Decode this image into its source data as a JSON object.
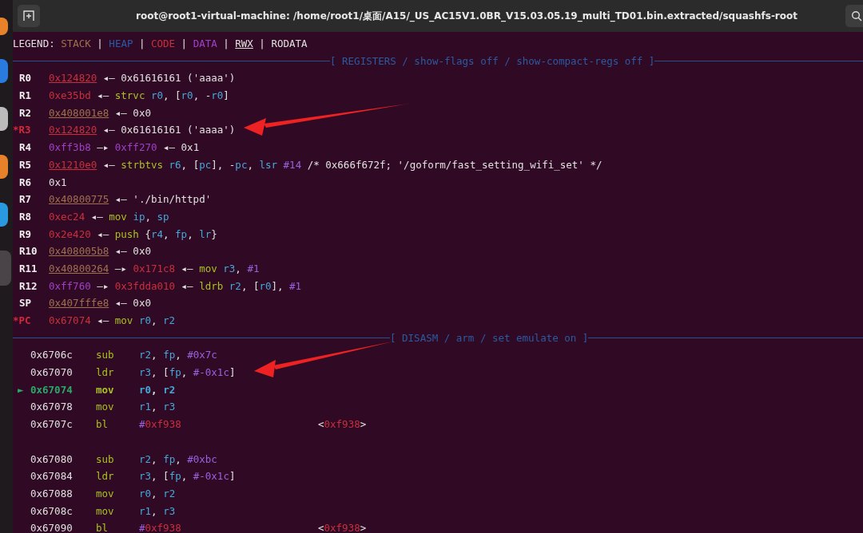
{
  "window": {
    "title": "root@root1-virtual-machine: /home/root1/桌面/A15/_US_AC15V1.0BR_V15.03.05.19_multi_TD01.bin.extracted/squashfs-root"
  },
  "legend": {
    "label": "LEGEND:",
    "separator": "|",
    "items": [
      {
        "text": "STACK",
        "kind": "stack"
      },
      {
        "text": "HEAP",
        "kind": "heap"
      },
      {
        "text": "CODE",
        "kind": "code"
      },
      {
        "text": "DATA",
        "kind": "data"
      },
      {
        "text": "RWX",
        "kind": "rwx"
      },
      {
        "text": "RODATA",
        "kind": "plain"
      }
    ]
  },
  "registers": {
    "header": "[ REGISTERS / show-flags off / show-compact-regs off ]",
    "rows": [
      {
        "name": "R0",
        "changed": false,
        "parts": [
          {
            "text": "0x124820",
            "kind": "rwxcode"
          },
          {
            "text": " ◂— 0x61616161 ('aaaa')",
            "kind": "plain"
          }
        ]
      },
      {
        "name": "R1",
        "changed": false,
        "parts": [
          {
            "text": "0xe35bd",
            "kind": "code"
          },
          {
            "text": " ◂— ",
            "kind": "plain"
          },
          {
            "text": "strvc ",
            "kind": "op"
          },
          {
            "text": "r0",
            "kind": "reg"
          },
          {
            "text": ", [",
            "kind": "plain"
          },
          {
            "text": "r0",
            "kind": "reg"
          },
          {
            "text": ", -",
            "kind": "plain"
          },
          {
            "text": "r0",
            "kind": "reg"
          },
          {
            "text": "]",
            "kind": "plain"
          }
        ]
      },
      {
        "name": "R2",
        "changed": false,
        "parts": [
          {
            "text": "0x408001e8",
            "kind": "rwxstack"
          },
          {
            "text": " ◂— 0x0",
            "kind": "plain"
          }
        ]
      },
      {
        "name": "*R3",
        "changed": true,
        "parts": [
          {
            "text": "0x124820",
            "kind": "rwxcode"
          },
          {
            "text": " ◂— 0x61616161 ('aaaa')",
            "kind": "plain"
          }
        ]
      },
      {
        "name": "R4",
        "changed": false,
        "parts": [
          {
            "text": "0xff3b8",
            "kind": "data"
          },
          {
            "text": " —▸ ",
            "kind": "plain"
          },
          {
            "text": "0xff270",
            "kind": "data"
          },
          {
            "text": " ◂— 0x1",
            "kind": "plain"
          }
        ]
      },
      {
        "name": "R5",
        "changed": false,
        "parts": [
          {
            "text": "0x1210e0",
            "kind": "rwxcode"
          },
          {
            "text": " ◂— ",
            "kind": "plain"
          },
          {
            "text": "strbtvs ",
            "kind": "op"
          },
          {
            "text": "r6",
            "kind": "reg"
          },
          {
            "text": ", [",
            "kind": "plain"
          },
          {
            "text": "pc",
            "kind": "reg"
          },
          {
            "text": "], -",
            "kind": "plain"
          },
          {
            "text": "pc",
            "kind": "reg"
          },
          {
            "text": ", ",
            "kind": "plain"
          },
          {
            "text": "lsr ",
            "kind": "reg"
          },
          {
            "text": "#14",
            "kind": "imm"
          },
          {
            "text": " /* 0x666f672f; '/goform/fast_setting_wifi_set' */",
            "kind": "plain"
          }
        ]
      },
      {
        "name": "R6",
        "changed": false,
        "parts": [
          {
            "text": "0x1",
            "kind": "plain"
          }
        ]
      },
      {
        "name": "R7",
        "changed": false,
        "parts": [
          {
            "text": "0x40800775",
            "kind": "rwxstack"
          },
          {
            "text": " ◂— './bin/httpd'",
            "kind": "plain"
          }
        ]
      },
      {
        "name": "R8",
        "changed": false,
        "parts": [
          {
            "text": "0xec24",
            "kind": "code"
          },
          {
            "text": " ◂— ",
            "kind": "plain"
          },
          {
            "text": "mov ",
            "kind": "op"
          },
          {
            "text": "ip",
            "kind": "reg"
          },
          {
            "text": ", ",
            "kind": "plain"
          },
          {
            "text": "sp",
            "kind": "reg"
          }
        ]
      },
      {
        "name": "R9",
        "changed": false,
        "parts": [
          {
            "text": "0x2e420",
            "kind": "code"
          },
          {
            "text": " ◂— ",
            "kind": "plain"
          },
          {
            "text": "push",
            "kind": "op"
          },
          {
            "text": " {",
            "kind": "plain"
          },
          {
            "text": "r4",
            "kind": "reg"
          },
          {
            "text": ", ",
            "kind": "plain"
          },
          {
            "text": "fp",
            "kind": "reg"
          },
          {
            "text": ", ",
            "kind": "plain"
          },
          {
            "text": "lr",
            "kind": "reg"
          },
          {
            "text": "}",
            "kind": "plain"
          }
        ]
      },
      {
        "name": "R10",
        "changed": false,
        "parts": [
          {
            "text": "0x408005b8",
            "kind": "rwxstack"
          },
          {
            "text": " ◂— 0x0",
            "kind": "plain"
          }
        ]
      },
      {
        "name": "R11",
        "changed": false,
        "parts": [
          {
            "text": "0x40800264",
            "kind": "rwxstack"
          },
          {
            "text": " —▸ ",
            "kind": "plain"
          },
          {
            "text": "0x171c8",
            "kind": "code"
          },
          {
            "text": " ◂— ",
            "kind": "plain"
          },
          {
            "text": "mov ",
            "kind": "op"
          },
          {
            "text": "r3",
            "kind": "reg"
          },
          {
            "text": ", ",
            "kind": "plain"
          },
          {
            "text": "#1",
            "kind": "imm"
          }
        ]
      },
      {
        "name": "R12",
        "changed": false,
        "parts": [
          {
            "text": "0xff760",
            "kind": "data"
          },
          {
            "text": " —▸ ",
            "kind": "plain"
          },
          {
            "text": "0x3fdda010",
            "kind": "code"
          },
          {
            "text": " ◂— ",
            "kind": "plain"
          },
          {
            "text": "ldrb ",
            "kind": "op"
          },
          {
            "text": "r2",
            "kind": "reg"
          },
          {
            "text": ", [",
            "kind": "plain"
          },
          {
            "text": "r0",
            "kind": "reg"
          },
          {
            "text": "], ",
            "kind": "plain"
          },
          {
            "text": "#1",
            "kind": "imm"
          }
        ]
      },
      {
        "name": "SP",
        "changed": false,
        "parts": [
          {
            "text": "0x407fffe8",
            "kind": "rwxstack"
          },
          {
            "text": " ◂— 0x0",
            "kind": "plain"
          }
        ]
      },
      {
        "name": "*PC",
        "changed": true,
        "parts": [
          {
            "text": "0x67074",
            "kind": "code"
          },
          {
            "text": " ◂— ",
            "kind": "plain"
          },
          {
            "text": "mov ",
            "kind": "op"
          },
          {
            "text": "r0",
            "kind": "reg"
          },
          {
            "text": ", ",
            "kind": "plain"
          },
          {
            "text": "r2",
            "kind": "reg"
          }
        ]
      }
    ]
  },
  "disasm": {
    "header": "[ DISASM / arm / set emulate on ]",
    "groups": [
      [
        {
          "current": false,
          "address": "0x6706c",
          "mnemonic": "sub",
          "operands": [
            {
              "text": "r2",
              "kind": "reg"
            },
            {
              "text": ", ",
              "kind": "plain"
            },
            {
              "text": "fp",
              "kind": "reg"
            },
            {
              "text": ", ",
              "kind": "plain"
            },
            {
              "text": "#0x7c",
              "kind": "imm"
            }
          ]
        },
        {
          "current": false,
          "address": "0x67070",
          "mnemonic": "ldr",
          "operands": [
            {
              "text": "r3",
              "kind": "reg"
            },
            {
              "text": ", [",
              "kind": "plain"
            },
            {
              "text": "fp",
              "kind": "reg"
            },
            {
              "text": ", ",
              "kind": "plain"
            },
            {
              "text": "#-0x1c",
              "kind": "imm"
            },
            {
              "text": "]",
              "kind": "plain"
            }
          ]
        },
        {
          "current": true,
          "marker": "►",
          "address": "0x67074",
          "mnemonic": "mov",
          "operands": [
            {
              "text": "r0",
              "kind": "reg"
            },
            {
              "text": ", ",
              "kind": "plain"
            },
            {
              "text": "r2",
              "kind": "reg"
            }
          ]
        },
        {
          "current": false,
          "address": "0x67078",
          "mnemonic": "mov",
          "operands": [
            {
              "text": "r1",
              "kind": "reg"
            },
            {
              "text": ", ",
              "kind": "plain"
            },
            {
              "text": "r3",
              "kind": "reg"
            }
          ]
        },
        {
          "current": false,
          "address": "0x6707c",
          "mnemonic": "bl",
          "operands": [
            {
              "text": "#",
              "kind": "imm"
            },
            {
              "text": "0xf938",
              "kind": "code"
            }
          ],
          "target": [
            {
              "text": "<",
              "kind": "plain"
            },
            {
              "text": "0xf938",
              "kind": "code"
            },
            {
              "text": ">",
              "kind": "plain"
            }
          ]
        }
      ],
      [
        {
          "current": false,
          "address": "0x67080",
          "mnemonic": "sub",
          "operands": [
            {
              "text": "r2",
              "kind": "reg"
            },
            {
              "text": ", ",
              "kind": "plain"
            },
            {
              "text": "fp",
              "kind": "reg"
            },
            {
              "text": ", ",
              "kind": "plain"
            },
            {
              "text": "#0xbc",
              "kind": "imm"
            }
          ]
        },
        {
          "current": false,
          "address": "0x67084",
          "mnemonic": "ldr",
          "operands": [
            {
              "text": "r3",
              "kind": "reg"
            },
            {
              "text": ", [",
              "kind": "plain"
            },
            {
              "text": "fp",
              "kind": "reg"
            },
            {
              "text": ", ",
              "kind": "plain"
            },
            {
              "text": "#-0x1c",
              "kind": "imm"
            },
            {
              "text": "]",
              "kind": "plain"
            }
          ]
        },
        {
          "current": false,
          "address": "0x67088",
          "mnemonic": "mov",
          "operands": [
            {
              "text": "r0",
              "kind": "reg"
            },
            {
              "text": ", ",
              "kind": "plain"
            },
            {
              "text": "r2",
              "kind": "reg"
            }
          ]
        },
        {
          "current": false,
          "address": "0x6708c",
          "mnemonic": "mov",
          "operands": [
            {
              "text": "r1",
              "kind": "reg"
            },
            {
              "text": ", ",
              "kind": "plain"
            },
            {
              "text": "r3",
              "kind": "reg"
            }
          ]
        },
        {
          "current": false,
          "address": "0x67090",
          "mnemonic": "bl",
          "operands": [
            {
              "text": "#",
              "kind": "imm"
            },
            {
              "text": "0xf938",
              "kind": "code"
            }
          ],
          "target": [
            {
              "text": "<",
              "kind": "plain"
            },
            {
              "text": "0xf938",
              "kind": "code"
            },
            {
              "text": ">",
              "kind": "plain"
            }
          ]
        }
      ]
    ]
  }
}
